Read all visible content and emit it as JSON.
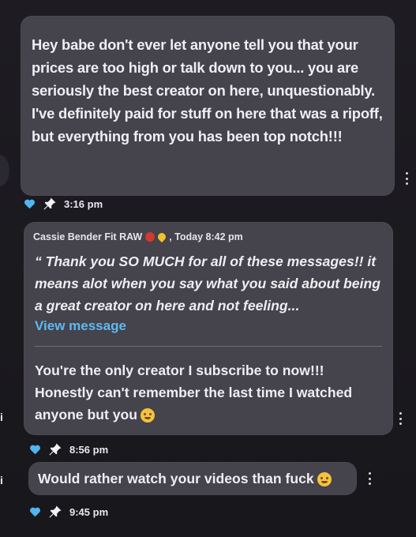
{
  "messages": [
    {
      "text": "Hey babe don't ever let anyone tell you that your prices are too high or talk down to you... you are seriously the best creator on here, unquestionably. I've definitely paid for stuff on here that was a ripoff, but everything from you has been top notch!!!",
      "time": "3:16 pm"
    },
    {
      "reply_to": {
        "sender": "Cassie Bender Fit RAW",
        "time": ", Today 8:42 pm",
        "quote": "“ Thank you SO MUCH for all of these messages!! it means alot when you say what you said about being a great creator on here and not feeling...",
        "view_label": "View message"
      },
      "text": "You're the only creator I subscribe to now!!! Honestly can't remember the last time I watched anyone but you",
      "time": "8:56 pm"
    },
    {
      "text": "Would rather watch your videos than fuck",
      "time": "9:45 pm"
    }
  ],
  "icons": {
    "heart": "heart-icon",
    "pin": "pin-icon",
    "more": "kebab-menu-icon"
  },
  "colors": {
    "bubble": "#45434b",
    "heart": "#4fb7f0",
    "link": "#5fb8f5"
  }
}
